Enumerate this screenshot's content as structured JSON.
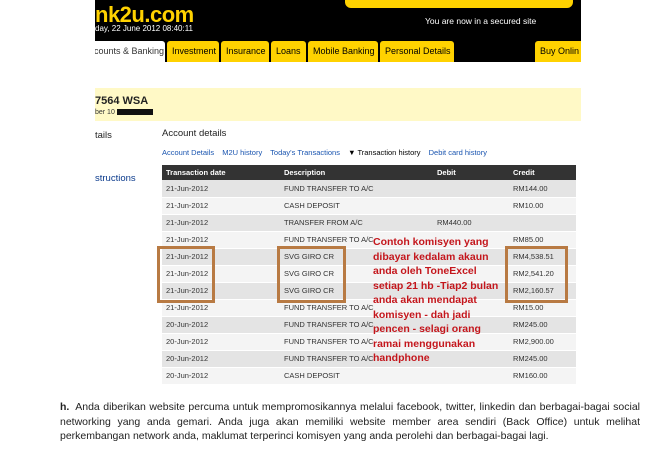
{
  "header": {
    "logo": "nk2u.com",
    "datetime": "day, 22 June 2012 08:40:11",
    "secured": "You are now in a secured site"
  },
  "nav": {
    "tabs": [
      {
        "label": "counts & Banking",
        "active": true
      },
      {
        "label": "Investment",
        "active": false
      },
      {
        "label": "Insurance",
        "active": false
      },
      {
        "label": "Loans",
        "active": false
      },
      {
        "label": "Mobile Banking",
        "active": false
      },
      {
        "label": "Personal Details",
        "active": false
      },
      {
        "label": "Buy Onlin",
        "active": false
      }
    ]
  },
  "account": {
    "number": "7564 WSA",
    "subline": "ber 10"
  },
  "sidebar": {
    "item1": "tails",
    "item2": "structions"
  },
  "details": {
    "title": "Account details",
    "subnav": [
      {
        "label": "Account Details",
        "active": false
      },
      {
        "label": "M2U history",
        "active": false
      },
      {
        "label": "Today's Transactions",
        "active": false
      },
      {
        "label": "▼ Transaction history",
        "active": true
      },
      {
        "label": "Debit card history",
        "active": false
      }
    ]
  },
  "table": {
    "headers": [
      "Transaction date",
      "Description",
      "Debit",
      "Credit"
    ],
    "rows": [
      [
        "21-Jun-2012",
        "FUND TRANSFER TO A/C",
        "",
        "RM144.00"
      ],
      [
        "21-Jun-2012",
        "CASH DEPOSIT",
        "",
        "RM10.00"
      ],
      [
        "21-Jun-2012",
        "TRANSFER FROM A/C",
        "RM440.00",
        ""
      ],
      [
        "21-Jun-2012",
        "FUND TRANSFER TO A/C",
        "",
        "RM85.00"
      ],
      [
        "21-Jun-2012",
        "SVG GIRO CR",
        "",
        "RM4,538.51"
      ],
      [
        "21-Jun-2012",
        "SVG GIRO CR",
        "",
        "RM2,541.20"
      ],
      [
        "21-Jun-2012",
        "SVG GIRO CR",
        "",
        "RM2,160.57"
      ],
      [
        "21-Jun-2012",
        "FUND TRANSFER TO A/C",
        "",
        "RM15.00"
      ],
      [
        "20-Jun-2012",
        "FUND TRANSFER TO A/C",
        "",
        "RM245.00"
      ],
      [
        "20-Jun-2012",
        "FUND TRANSFER TO A/C",
        "",
        "RM2,900.00"
      ],
      [
        "20-Jun-2012",
        "FUND TRANSFER TO A/C",
        "",
        "RM245.00"
      ],
      [
        "20-Jun-2012",
        "CASH DEPOSIT",
        "",
        "RM160.00"
      ]
    ]
  },
  "note": "Contoh komisyen yang dibayar kedalam akaun anda oleh ToneExcel setiap 21 hb -Tiap2 bulan anda akan mendapat komisyen - dah jadi pencen - selagi orang ramai menggunakan handphone",
  "paragraph": {
    "label": "h.",
    "text": "Anda diberikan website percuma untuk mempromosikannya melalui facebook, twitter, linkedin dan berbagai-bagai social networking yang anda gemari. Anda juga akan memiliki website member area sendiri (Back Office) untuk melihat perkembangan network anda, maklumat terperinci komisyen yang anda perolehi dan berbagai-bagai lagi."
  },
  "colors": {
    "brand_yellow": "#ffd200",
    "header_black": "#000000",
    "highlight_border": "#b87a43",
    "note_red": "#c4161c"
  }
}
